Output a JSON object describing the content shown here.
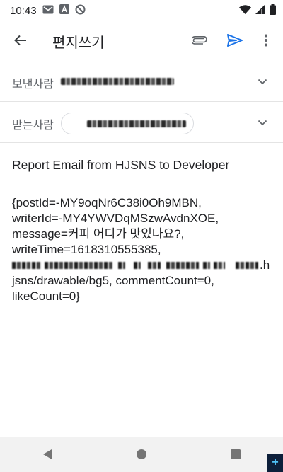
{
  "status_bar": {
    "time": "10:43",
    "icons": [
      "gmail-notification-icon",
      "a-notification-icon",
      "blocked-icon",
      "wifi-icon",
      "signal-icon",
      "battery-icon"
    ]
  },
  "app_bar": {
    "title": "편지쓰기",
    "icons": [
      "back-arrow-icon",
      "attach-icon",
      "send-icon",
      "more-vert-icon"
    ],
    "send_color": "#1a73e8"
  },
  "from": {
    "label": "보낸사람"
  },
  "to": {
    "label": "받는사람"
  },
  "subject": "Report Email from HJSNS to Developer",
  "body": {
    "lines": [
      "{postId=-MY9oqNr6C38i0Oh9MBN,",
      "writerId=-MY4YWVDqMSzwAvdnXOE,",
      "message=커피 어디가 맛있나요?,",
      "writeTime=1618310555385,"
    ],
    "line5_tail": ".h",
    "lines_after": [
      "jsns/drawable/bg5, commentCount=0,",
      "likeCount=0}"
    ]
  },
  "nav_bar": {
    "buttons": [
      "back-triangle-icon",
      "home-circle-icon",
      "recents-square-icon"
    ]
  },
  "corner_badge": "+"
}
